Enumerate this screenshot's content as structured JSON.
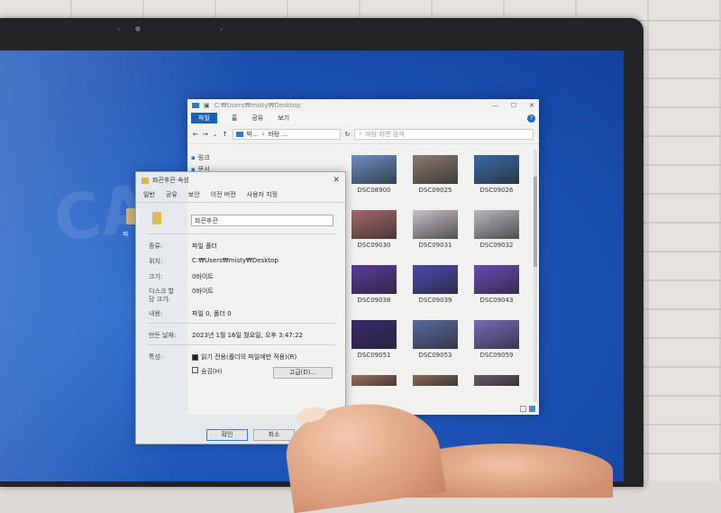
{
  "desktop": {
    "icon_label": "파"
  },
  "explorer": {
    "path": "C:₩Users₩misty₩Desktop",
    "tabs": [
      "파일",
      "홈",
      "공유",
      "보기"
    ],
    "address": [
      "박...",
      "바탕 ..."
    ],
    "search_placeholder": "바탕 화면 검색",
    "nav": [
      {
        "label": "링크"
      },
      {
        "label": "문서"
      }
    ],
    "files": [
      {
        "name": "DSC08900",
        "color": "#6b8ec4"
      },
      {
        "name": "DSC09025",
        "color": "#8a7a70"
      },
      {
        "name": "DSC09026",
        "color": "#3a6aa8"
      },
      {
        "name": "DSC09030",
        "color": "#a86a6a"
      },
      {
        "name": "DSC09031",
        "color": "#c8c0c8"
      },
      {
        "name": "DSC09032",
        "color": "#b8b8c0"
      },
      {
        "name": "DSC09038",
        "color": "#5a3aa0"
      },
      {
        "name": "DSC09039",
        "color": "#4a4ab0"
      },
      {
        "name": "DSC09043",
        "color": "#6a4ab8"
      },
      {
        "name": "DSC09051",
        "color": "#3a2a70"
      },
      {
        "name": "DSC09053",
        "color": "#5a6aa0"
      },
      {
        "name": "DSC09059",
        "color": "#7a6ab8"
      },
      {
        "name": "",
        "color": "#a07060"
      },
      {
        "name": "",
        "color": "#8a6a5a"
      },
      {
        "name": "",
        "color": "#6a5a6a"
      }
    ]
  },
  "props": {
    "title": "퍄끈후끈 속성",
    "tabs": [
      "일반",
      "공유",
      "보안",
      "이전 버전",
      "사용자 지정"
    ],
    "name": "퍄끈후끈",
    "rows": [
      {
        "k": "종류:",
        "v": "파일 폴더"
      },
      {
        "k": "위치:",
        "v": "C:₩Users₩misty₩Desktop"
      },
      {
        "k": "크기:",
        "v": "0바이트"
      },
      {
        "k": "디스크 할",
        "v": "0바이트"
      },
      {
        "k": "당 크기:",
        "v": ""
      },
      {
        "k": "내용:",
        "v": "파일 0, 폴더 0"
      },
      {
        "k": "만든 날짜:",
        "v": "2023년 1월 16일 월요일, 오후 3:47:22"
      },
      {
        "k": "특성:",
        "v": "읽기 전용(폴더의 파일에만 적용)(R)"
      }
    ],
    "hidden_label": "숨김(H)",
    "advanced_label": "고급(D)...",
    "ok_label": "확인",
    "cancel_label": "취소"
  }
}
